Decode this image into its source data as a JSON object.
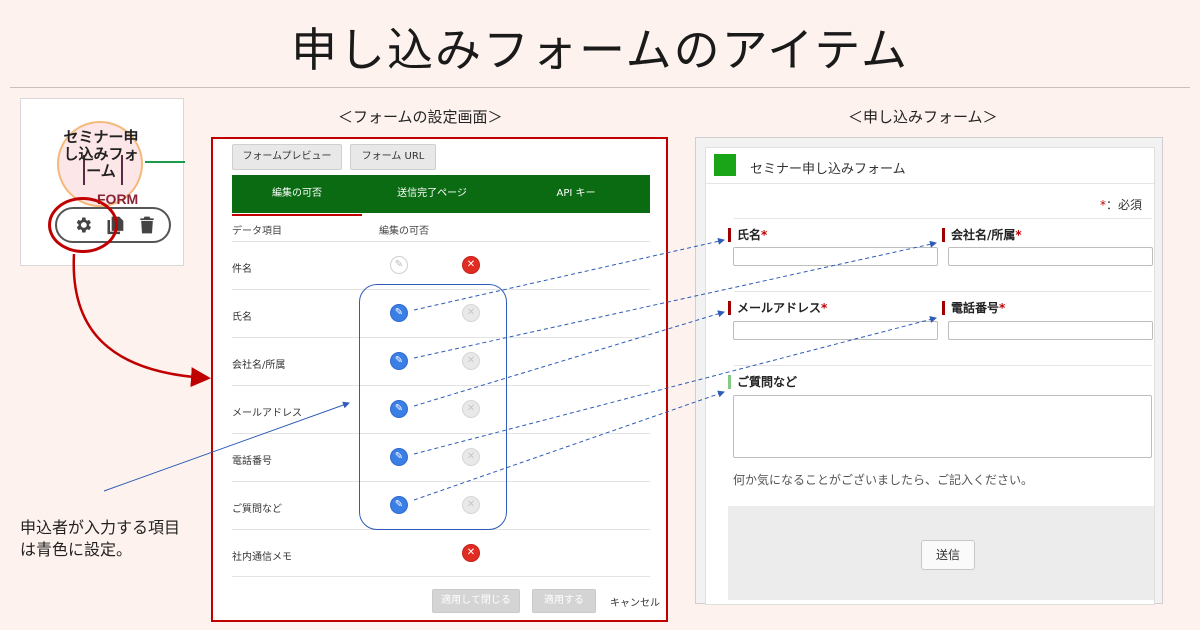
{
  "title": "申し込みフォームのアイテム",
  "node": {
    "text_line1": "セミナー申",
    "text_line2": "し込みフォ",
    "text_line3": "ーム",
    "form_label": "FORM"
  },
  "caption": {
    "line1": "申込者が入力する項目",
    "line2": "は青色に設定。"
  },
  "settings_section_label": "＜フォームの設定画面＞",
  "form_section_label": "＜申し込みフォーム＞",
  "settings": {
    "buttons": [
      "フォームプレビュー",
      "フォーム URL"
    ],
    "tabs": [
      "編集の可否",
      "送信完了ページ",
      "API キー"
    ],
    "active_tab": "編集の可否",
    "headers": [
      "データ項目",
      "編集の可否"
    ],
    "rows": [
      {
        "label": "件名",
        "edit": "grey",
        "hide": "red"
      },
      {
        "label": "氏名",
        "edit": "blue",
        "hide": "greyfill"
      },
      {
        "label": "会社名/所属",
        "edit": "blue",
        "hide": "greyfill"
      },
      {
        "label": "メールアドレス",
        "edit": "blue",
        "hide": "greyfill"
      },
      {
        "label": "電話番号",
        "edit": "blue",
        "hide": "greyfill"
      },
      {
        "label": "ご質問など",
        "edit": "blue",
        "hide": "greyfill"
      },
      {
        "label": "社内通信メモ",
        "edit": "none",
        "hide": "red"
      }
    ],
    "footer": {
      "apply_close": "適用して閉じる",
      "apply": "適用する",
      "cancel": "キャンセル"
    }
  },
  "form": {
    "title": "セミナー申し込みフォーム",
    "required_note_star": "*",
    "required_note": "：必須",
    "fields": {
      "name": "氏名",
      "company": "会社名/所属",
      "email": "メールアドレス",
      "phone": "電話番号",
      "questions": "ご質問など"
    },
    "required_star": "*",
    "hint": "何か気になることがございましたら、ご記入ください。",
    "submit": "送信"
  },
  "colors": {
    "accent_red": "#c00000",
    "tab_green": "#0a6b12",
    "toggle_blue": "#3b7ee6"
  }
}
